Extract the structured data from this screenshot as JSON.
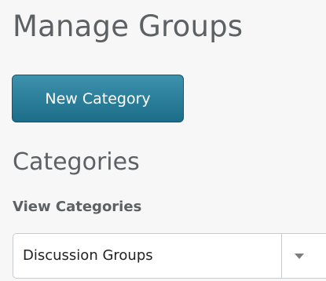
{
  "header": {
    "title": "Manage Groups"
  },
  "toolbar": {
    "new_category_label": "New Category"
  },
  "categories": {
    "heading": "Categories",
    "view_label": "View Categories",
    "selected_option": "Discussion Groups",
    "dropdown_icon": "chevron-down-icon"
  },
  "colors": {
    "button_primary": "#2a7f9b",
    "text_muted": "#5d6163",
    "background": "#f7f7f7"
  }
}
